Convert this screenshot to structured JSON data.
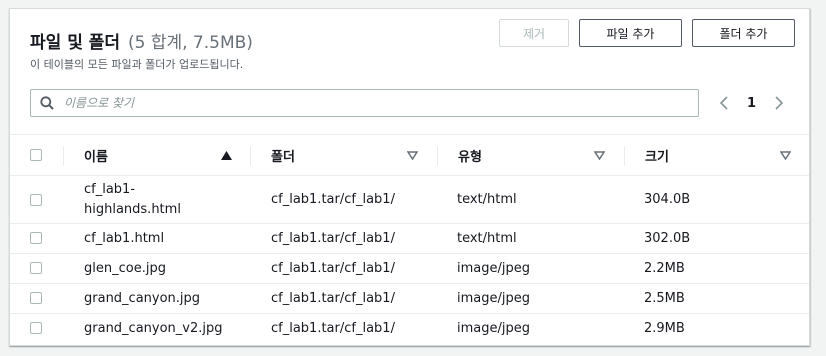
{
  "header": {
    "title": "파일 및 폴더",
    "count": "(5 합계, 7.5MB)",
    "subtitle": "이 테이블의 모든 파일과 폴더가 업로드됩니다."
  },
  "actions": {
    "remove_label": "제거",
    "add_files_label": "파일 추가",
    "add_folder_label": "폴더 추가"
  },
  "search": {
    "placeholder": "이름으로 찾기",
    "value": ""
  },
  "pagination": {
    "current_page": "1"
  },
  "table": {
    "columns": [
      {
        "label": "이름",
        "sort": "ascending"
      },
      {
        "label": "폴더",
        "sort": "none"
      },
      {
        "label": "유형",
        "sort": "none"
      },
      {
        "label": "크기",
        "sort": "none"
      }
    ],
    "rows": [
      {
        "name_line1": "cf_lab1-",
        "name_line2": "highlands.html",
        "folder": "cf_lab1.tar/cf_lab1/",
        "type": "text/html",
        "size": "304.0B"
      },
      {
        "name": "cf_lab1.html",
        "folder": "cf_lab1.tar/cf_lab1/",
        "type": "text/html",
        "size": "302.0B"
      },
      {
        "name": "glen_coe.jpg",
        "folder": "cf_lab1.tar/cf_lab1/",
        "type": "image/jpeg",
        "size": "2.2MB"
      },
      {
        "name": "grand_canyon.jpg",
        "folder": "cf_lab1.tar/cf_lab1/",
        "type": "image/jpeg",
        "size": "2.5MB"
      },
      {
        "name": "grand_canyon_v2.jpg",
        "folder": "cf_lab1.tar/cf_lab1/",
        "type": "image/jpeg",
        "size": "2.9MB"
      }
    ]
  },
  "colors": {
    "text": "#16191f",
    "muted": "#687078",
    "border": "#aab7b8",
    "divider": "#eaeded",
    "disabled": "#aab7b8"
  },
  "icons": {
    "search": "search-icon",
    "prev": "chevron-left-icon",
    "next": "chevron-right-icon",
    "sort_asc": "sort-ascending-icon",
    "sort_none": "sort-caret-down-icon"
  }
}
